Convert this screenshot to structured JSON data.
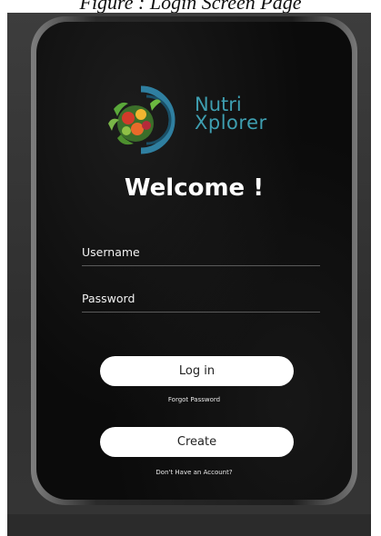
{
  "caption": "Figure : Login Screen Page",
  "logo": {
    "line1": "Nutri",
    "line2": "Xplorer",
    "accent_color": "#3e9eb0"
  },
  "welcome": "Welcome !",
  "username": {
    "label": "Username"
  },
  "password": {
    "label": "Password"
  },
  "login_button": "Log in",
  "forgot_password": "Forgot Password",
  "create_button": "Create",
  "no_account": "Don't Have an Account?"
}
